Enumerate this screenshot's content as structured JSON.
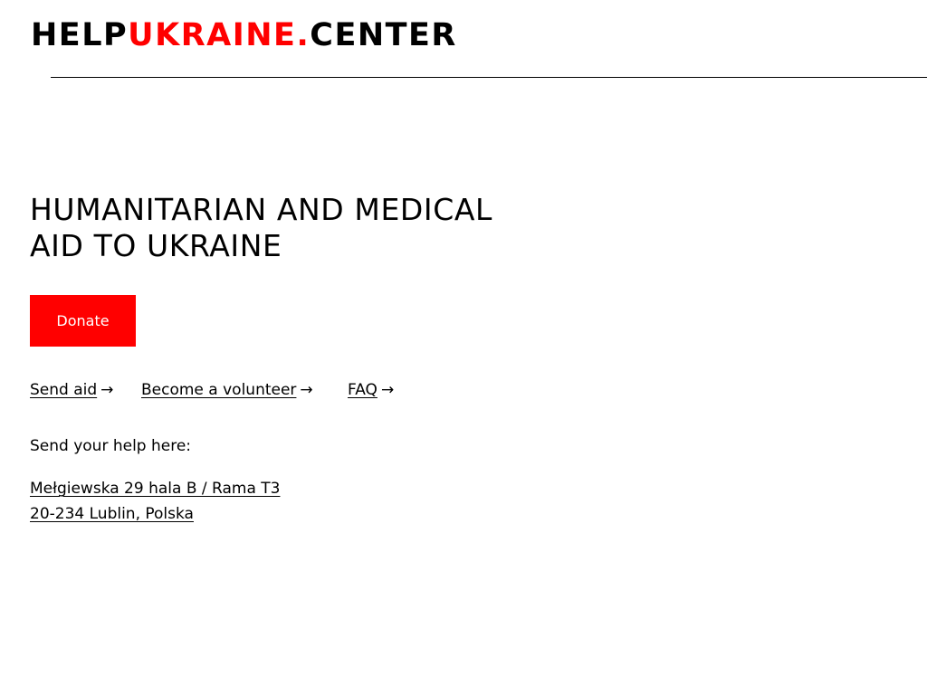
{
  "header": {
    "logo": {
      "part1": "HELP",
      "part2": "UKRAINE.",
      "part3": "CENTER"
    }
  },
  "colors": {
    "accent": "#ff0000",
    "text": "#000000",
    "background": "#ffffff"
  },
  "hero": {
    "headline_line1": "HUMANITARIAN AND MEDICAL",
    "headline_line2": "AID TO UKRAINE",
    "donate_label": "Donate"
  },
  "links": [
    {
      "label": "Send aid",
      "icon": "arrow-right-icon"
    },
    {
      "label": "Become a volunteer",
      "icon": "arrow-right-icon"
    },
    {
      "label": "FAQ",
      "icon": "arrow-right-icon"
    }
  ],
  "address_section": {
    "label": "Send your help here:",
    "line1": "Mełgiewska 29 hala B / Rama T3",
    "line2": "20-234 Lublin, Polska"
  }
}
